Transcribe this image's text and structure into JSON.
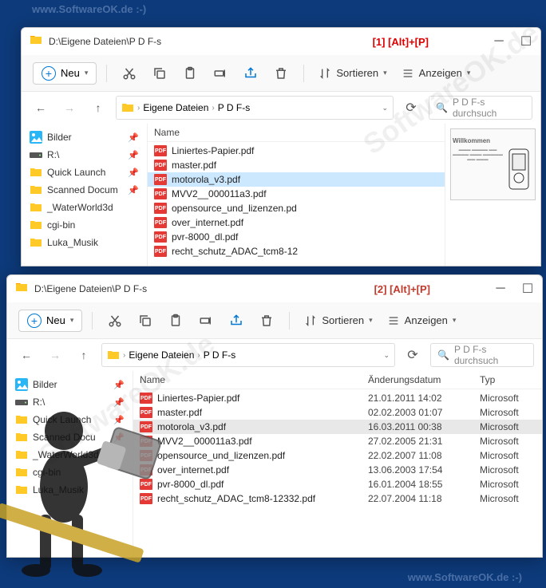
{
  "watermark": "www.SoftwareOK.de :-)",
  "watermark_diag": "SoftwareOK.de",
  "window1": {
    "title": "D:\\Eigene Dateien\\P D F-s",
    "annotation": "[1]   [Alt]+[P]",
    "toolbar": {
      "new": "Neu",
      "sort": "Sortieren",
      "view": "Anzeigen"
    },
    "breadcrumb": {
      "p1": "Eigene Dateien",
      "p2": "P D F-s"
    },
    "search_placeholder": "P D F-s durchsuch",
    "sidebar": [
      {
        "label": "Bilder",
        "icon": "picture",
        "pin": true
      },
      {
        "label": "R:\\",
        "icon": "drive",
        "pin": true
      },
      {
        "label": "Quick Launch",
        "icon": "folder",
        "pin": true
      },
      {
        "label": "Scanned Docum",
        "icon": "folder",
        "pin": true
      },
      {
        "label": "_WaterWorld3d",
        "icon": "folder",
        "pin": false
      },
      {
        "label": "cgi-bin",
        "icon": "folder",
        "pin": false
      },
      {
        "label": "Luka_Musik",
        "icon": "folder",
        "pin": false
      }
    ],
    "columns": {
      "name": "Name"
    },
    "files": [
      {
        "name": "Liniertes-Papier.pdf"
      },
      {
        "name": "master.pdf"
      },
      {
        "name": "motorola_v3.pdf",
        "selected": true
      },
      {
        "name": "MVV2__000011a3.pdf"
      },
      {
        "name": "opensource_und_lizenzen.pd"
      },
      {
        "name": "over_internet.pdf"
      },
      {
        "name": "pvr-8000_dl.pdf"
      },
      {
        "name": "recht_schutz_ADAC_tcm8-12"
      }
    ],
    "preview_title": "Willkommen"
  },
  "window2": {
    "title": "D:\\Eigene Dateien\\P D F-s",
    "annotation": "[2]   [Alt]+[P]",
    "toolbar": {
      "new": "Neu",
      "sort": "Sortieren",
      "view": "Anzeigen"
    },
    "breadcrumb": {
      "p1": "Eigene Dateien",
      "p2": "P D F-s"
    },
    "search_placeholder": "P D F-s durchsuch",
    "sidebar": [
      {
        "label": "Bilder",
        "icon": "picture",
        "pin": true
      },
      {
        "label": "R:\\",
        "icon": "drive",
        "pin": true
      },
      {
        "label": "Quick Launch",
        "icon": "folder",
        "pin": true
      },
      {
        "label": "Scanned Docu",
        "icon": "folder",
        "pin": true
      },
      {
        "label": "_WaterWorld3d",
        "icon": "folder",
        "pin": false
      },
      {
        "label": "cgi-bin",
        "icon": "folder",
        "pin": false
      },
      {
        "label": "Luka_Musik",
        "icon": "folder",
        "pin": false
      }
    ],
    "columns": {
      "name": "Name",
      "date": "Änderungsdatum",
      "type": "Typ"
    },
    "files": [
      {
        "name": "Liniertes-Papier.pdf",
        "date": "21.01.2011 14:02",
        "type": "Microsoft"
      },
      {
        "name": "master.pdf",
        "date": "02.02.2003 01:07",
        "type": "Microsoft"
      },
      {
        "name": "motorola_v3.pdf",
        "date": "16.03.2011 00:38",
        "type": "Microsoft",
        "selected": true
      },
      {
        "name": "MVV2__000011a3.pdf",
        "date": "27.02.2005 21:31",
        "type": "Microsoft"
      },
      {
        "name": "opensource_und_lizenzen.pdf",
        "date": "22.02.2007 11:08",
        "type": "Microsoft"
      },
      {
        "name": "over_internet.pdf",
        "date": "13.06.2003 17:54",
        "type": "Microsoft"
      },
      {
        "name": "pvr-8000_dl.pdf",
        "date": "16.01.2004 18:55",
        "type": "Microsoft"
      },
      {
        "name": "recht_schutz_ADAC_tcm8-12332.pdf",
        "date": "22.07.2004 11:18",
        "type": "Microsoft"
      }
    ]
  }
}
